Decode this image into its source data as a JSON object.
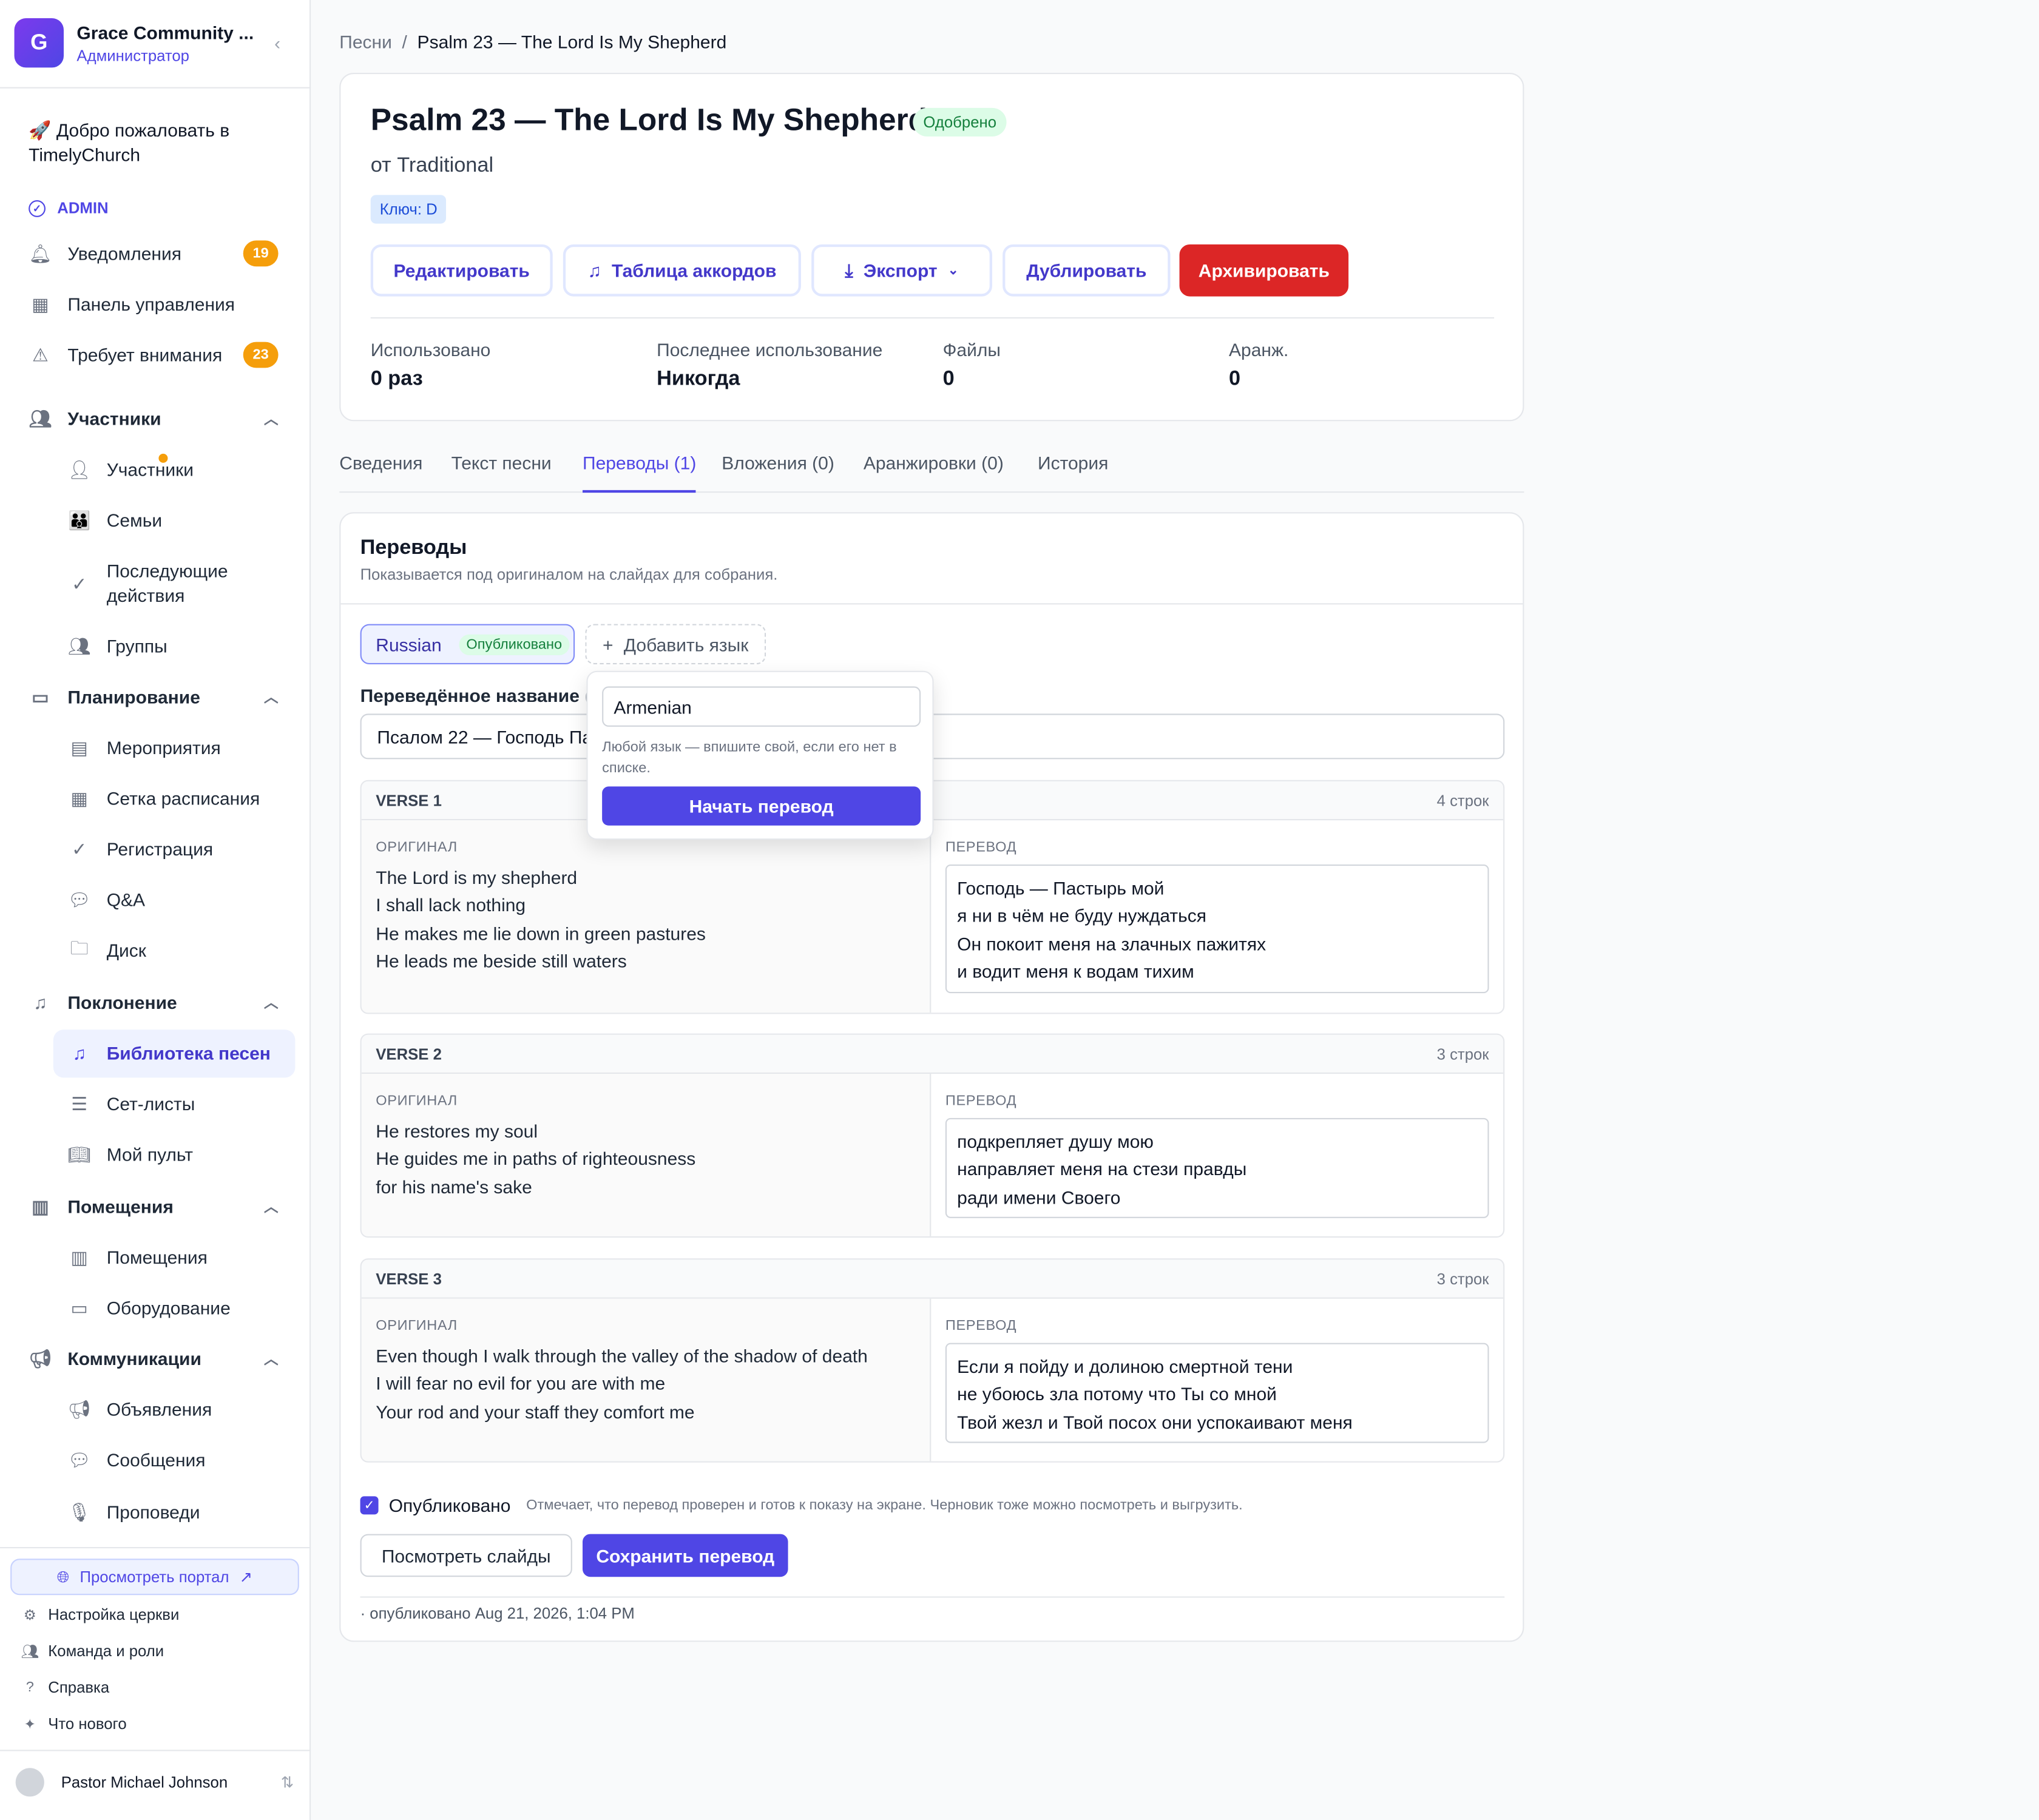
{
  "org": {
    "name": "Grace Community ...",
    "role": "Администратор",
    "logo_letter": "G"
  },
  "sidebar": {
    "welcome": "🚀 Добро пожаловать в TimelyChurch",
    "admin_label": "ADMIN",
    "notifications": {
      "label": "Уведомления",
      "badge": "19"
    },
    "dashboard": "Панель управления",
    "attention": {
      "label": "Требует внимания",
      "badge": "23"
    },
    "sections": {
      "members": {
        "label": "Участники",
        "items": [
          "Участники",
          "Семьи",
          "Последующие действия",
          "Группы"
        ]
      },
      "planning": {
        "label": "Планирование",
        "items": [
          "Мероприятия",
          "Сетка расписания",
          "Регистрация",
          "Q&A",
          "Диск"
        ]
      },
      "worship": {
        "label": "Поклонение",
        "items": [
          "Библиотека песен",
          "Сет-листы",
          "Мой пульт"
        ]
      },
      "rooms": {
        "label": "Помещения",
        "items": [
          "Помещения",
          "Оборудование"
        ]
      },
      "comms": {
        "label": "Коммуникации",
        "items": [
          "Объявления",
          "Сообщения",
          "Проповеди"
        ]
      }
    },
    "portal": "Просмотреть портал",
    "footer": [
      "Настройка церкви",
      "Команда и роли",
      "Справка",
      "Что нового"
    ],
    "user": "Pastor Michael Johnson"
  },
  "breadcrumb": {
    "parent": "Песни",
    "current": "Psalm 23 — The Lord Is My Shepherd"
  },
  "song": {
    "title": "Psalm 23 — The Lord Is My Shepherd",
    "status": "Одобрено",
    "author": "от Traditional",
    "key": "Ключ: D",
    "buttons": {
      "edit": "Редактировать",
      "chords": "Таблица аккордов",
      "export": "Экспорт",
      "duplicate": "Дублировать",
      "archive": "Архивировать"
    },
    "stats": [
      {
        "label": "Использовано",
        "value": "0 раз"
      },
      {
        "label": "Последнее использование",
        "value": "Никогда"
      },
      {
        "label": "Файлы",
        "value": "0"
      },
      {
        "label": "Аранж.",
        "value": "0"
      }
    ]
  },
  "tabs": [
    "Сведения",
    "Текст песни",
    "Переводы (1)",
    "Вложения (0)",
    "Аранжировки (0)",
    "История"
  ],
  "translations": {
    "heading": "Переводы",
    "subheading": "Показывается под оригиналом на слайдах для собрания.",
    "language": "Russian",
    "language_status": "Опубликовано",
    "add_language": "Добавить язык",
    "title_label": "Переведённое название",
    "title_label_hint": "(н",
    "title_value": "Псалом 22 — Господь Па",
    "original_caption": "ОРИГИНАЛ",
    "translation_caption": "ПЕРЕВОД",
    "verses": [
      {
        "name": "VERSE 1",
        "count": "4 строк",
        "original": [
          "The Lord is my shepherd",
          "I shall lack nothing",
          "He makes me lie down in green pastures",
          "He leads me beside still waters"
        ],
        "translation": [
          "Господь — Пастырь мой",
          "я ни в чём не буду нуждаться",
          "Он покоит меня на злачных пажитях",
          "и водит меня к водам тихим"
        ]
      },
      {
        "name": "VERSE 2",
        "count": "3 строк",
        "original": [
          "He restores my soul",
          "He guides me in paths of righteousness",
          "for his name's sake"
        ],
        "translation": [
          "подкрепляет душу мою",
          "направляет меня на стези правды",
          "ради имени Своего"
        ]
      },
      {
        "name": "VERSE 3",
        "count": "3 строк",
        "original": [
          "Even though I walk through the valley of the shadow of death",
          "I will fear no evil for you are with me",
          "Your rod and your staff they comfort me"
        ],
        "translation": [
          "Если я пойду и долиною смертной тени",
          "не убоюсь зла потому что Ты со мной",
          "Твой жезл и Твой посох они успокаивают меня"
        ]
      }
    ],
    "published_label": "Опубликовано",
    "published_hint": "Отмечает, что перевод проверен и готов к показу на экране. Черновик тоже можно посмотреть и выгрузить.",
    "view_slides": "Посмотреть слайды",
    "save": "Сохранить перевод",
    "meta": "· опубликовано Aug 21, 2026, 1:04 PM"
  },
  "popover": {
    "input_value": "Armenian",
    "hint": "Любой язык — впишите свой, если его нет в списке.",
    "button": "Начать перевод"
  },
  "colors": {
    "accent": "#4f46e5",
    "danger": "#dc2626",
    "badge": "#f59e0b",
    "success_bg": "#dcfce7"
  }
}
